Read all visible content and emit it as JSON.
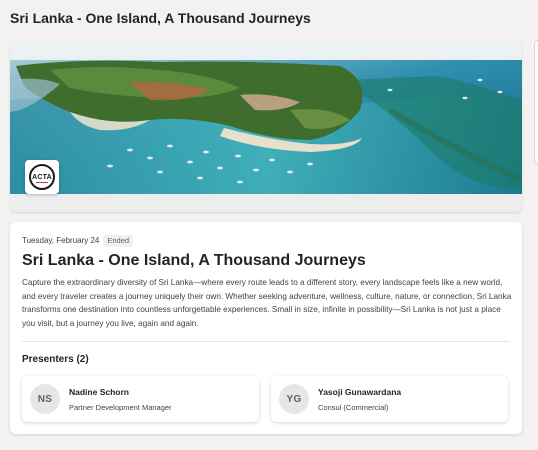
{
  "page": {
    "title": "Sri Lanka - One Island, A Thousand Journeys"
  },
  "banner": {
    "logo_text": "ACTA",
    "colors": {
      "ocean_deep": "#0f5f82",
      "lagoon": "#3fb6c0",
      "foliage": "#3f6d2e",
      "sand": "#e8e0cc",
      "logo_accent": "#d13438"
    }
  },
  "event": {
    "date": "Tuesday, February 24",
    "status": "Ended",
    "title": "Sri Lanka - One Island, A Thousand Journeys",
    "description": "Capture the extraordinary diversity of Sri Lanka—where every route leads to a different story, every landscape feels like a new world, and every traveler creates a journey uniquely their own. Whether seeking adventure, wellness, culture, nature, or connection, Sri Lanka transforms one destination into countless unforgettable experiences. Small in size, infinite in possibility—Sri Lanka is not just a place you visit, but a journey you live, again and again."
  },
  "presenters": {
    "heading": "Presenters (2)",
    "items": [
      {
        "initials": "NS",
        "name": "Nadine Schorn",
        "role": "Partner Development Manager"
      },
      {
        "initials": "YG",
        "name": "Yasoji Gunawardana",
        "role": "Consul (Commercial)"
      }
    ]
  }
}
